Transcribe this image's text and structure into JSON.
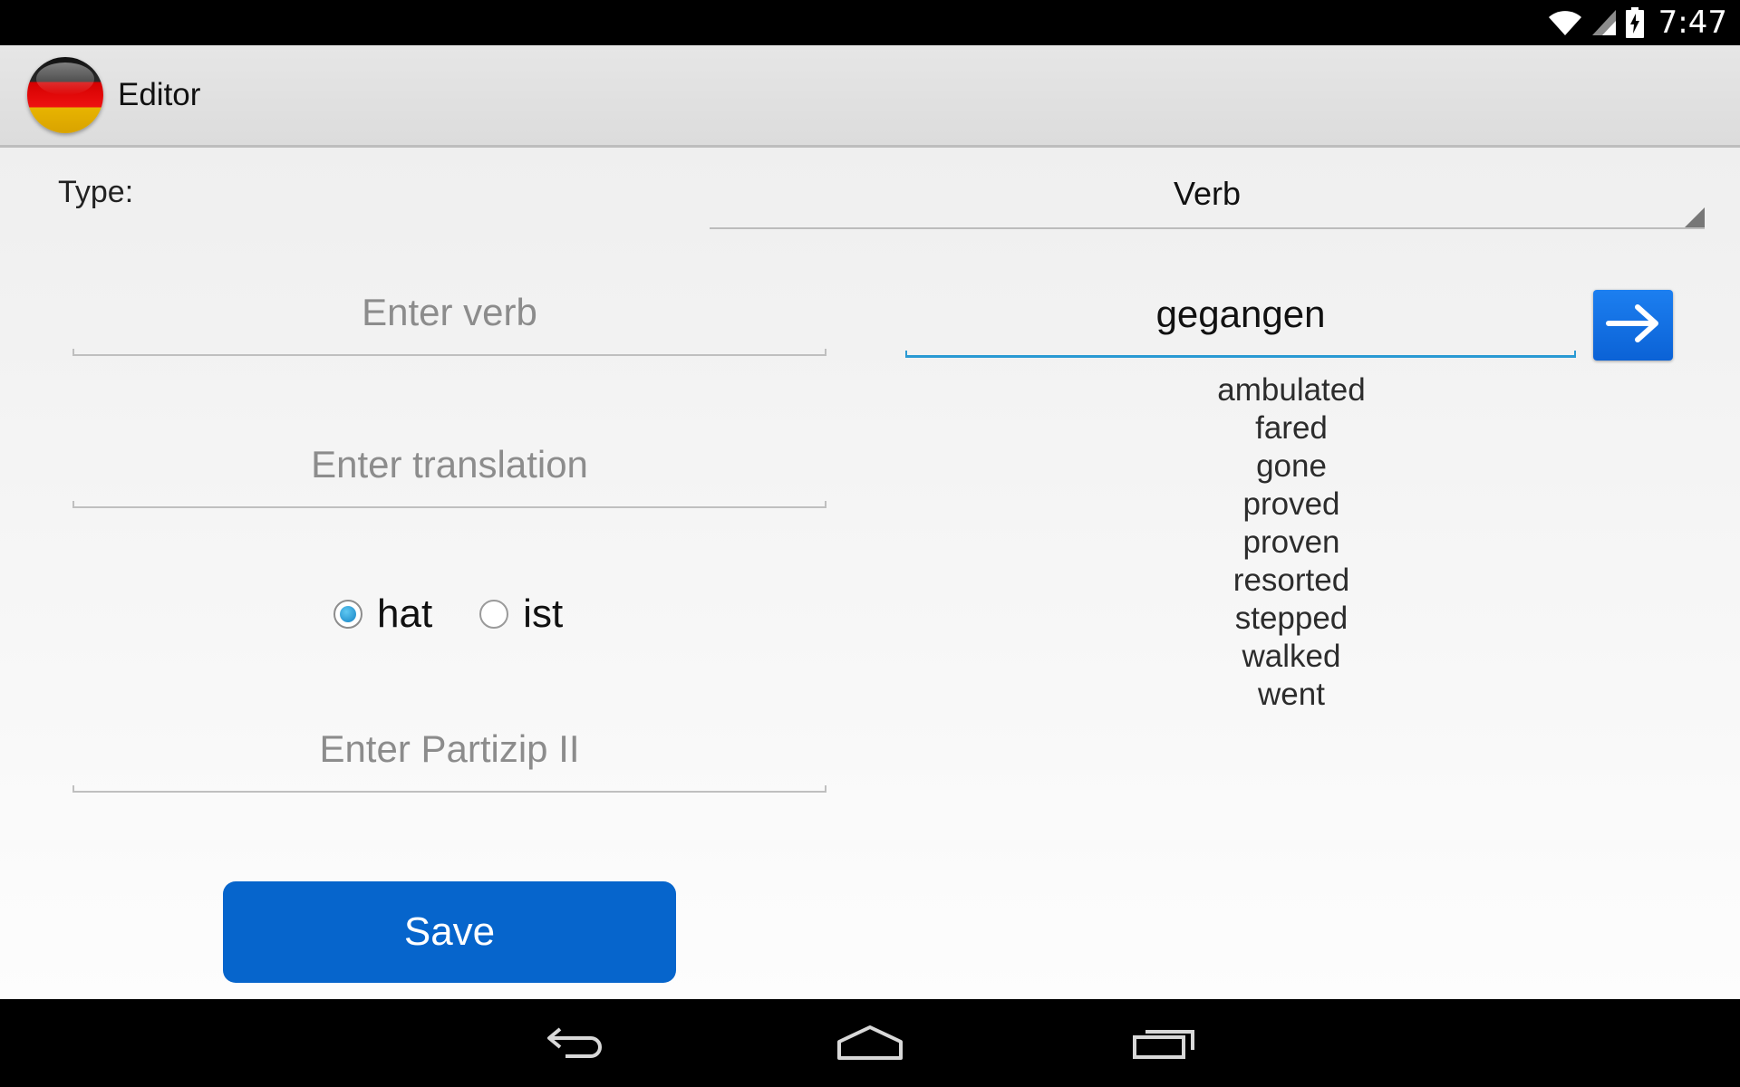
{
  "status_bar": {
    "time": "7:47",
    "icons": [
      "wifi-icon",
      "cell-signal-icon",
      "battery-charging-icon"
    ]
  },
  "action_bar": {
    "title": "Editor",
    "icon": "germany-flag-icon"
  },
  "form": {
    "type_label": "Type:",
    "type_value": "Verb",
    "verb_placeholder": "Enter verb",
    "verb_value": "",
    "translation_placeholder": "Enter translation",
    "translation_value": "",
    "auxiliary_options": [
      {
        "label": "hat",
        "checked": true
      },
      {
        "label": "ist",
        "checked": false
      }
    ],
    "partizip_placeholder": "Enter Partizip II",
    "partizip_value": "",
    "save_label": "Save"
  },
  "lookup": {
    "query": "gegangen",
    "go_icon": "arrow-right-icon",
    "suggestions": [
      "ambulated",
      "fared",
      "gone",
      "proved",
      "proven",
      "resorted",
      "stepped",
      "walked",
      "went"
    ]
  },
  "nav_bar": {
    "icons": [
      "back-icon",
      "home-icon",
      "recents-icon"
    ]
  },
  "colors": {
    "accent_blue": "#0665cc",
    "focus_line": "#2a9ad3",
    "go_button": "#1c7ff0"
  }
}
